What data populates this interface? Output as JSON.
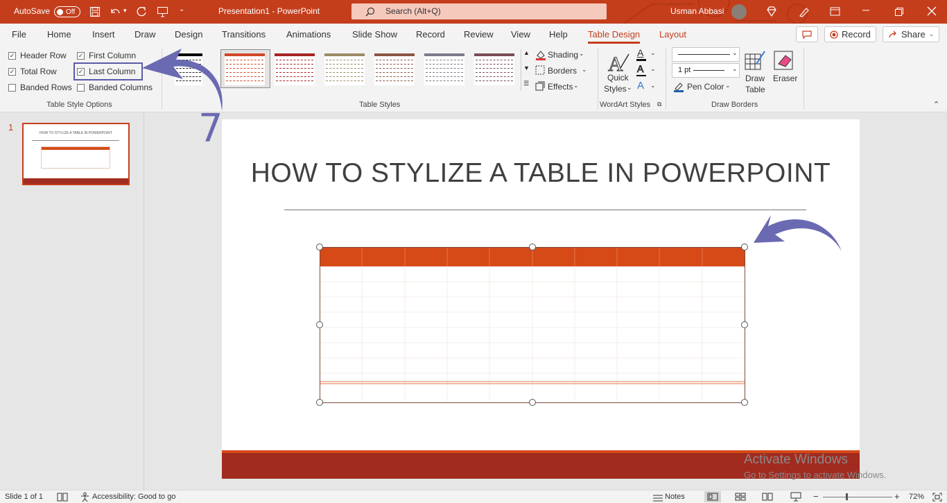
{
  "titlebar": {
    "autosave_label": "AutoSave",
    "autosave_state": "Off",
    "doc_title": "Presentation1  -  PowerPoint",
    "search_placeholder": "Search (Alt+Q)",
    "user_name": "Usman Abbasi"
  },
  "menu": {
    "tabs": [
      "File",
      "Home",
      "Insert",
      "Draw",
      "Design",
      "Transitions",
      "Animations",
      "Slide Show",
      "Record",
      "Review",
      "View",
      "Help",
      "Table Design",
      "Layout"
    ],
    "active_tab": "Table Design",
    "record_label": "Record",
    "share_label": "Share"
  },
  "ribbon": {
    "style_options": {
      "header_row": {
        "label": "Header Row",
        "checked": true
      },
      "first_column": {
        "label": "First Column",
        "checked": true
      },
      "total_row": {
        "label": "Total Row",
        "checked": true
      },
      "last_column": {
        "label": "Last Column",
        "checked": true
      },
      "banded_rows": {
        "label": "Banded Rows",
        "checked": false
      },
      "banded_columns": {
        "label": "Banded Columns",
        "checked": false
      },
      "group_label": "Table Style Options"
    },
    "table_styles": {
      "group_label": "Table Styles",
      "style_colors": [
        "#000000",
        "#d24726",
        "#a72424",
        "#9c8b66",
        "#8b5545",
        "#7d7a89",
        "#7a4d55"
      ]
    },
    "shading_label": "Shading",
    "borders_label": "Borders",
    "effects_label": "Effects",
    "quick_styles_label1": "Quick",
    "quick_styles_label2": "Styles",
    "wordart_label": "WordArt Styles",
    "pen_weight": "1 pt",
    "pen_color_label": "Pen Color",
    "draw_table_label1": "Draw",
    "draw_table_label2": "Table",
    "eraser_label": "Eraser",
    "draw_borders_label": "Draw Borders"
  },
  "annotation": {
    "step_number": "7",
    "arrow_color": "#6a6ab2"
  },
  "slide_panel": {
    "slide_number": "1",
    "thumb_title": "HOW TO STYLIZE A TABLE IN POWERPOINT"
  },
  "slide": {
    "title": "HOW TO STYLIZE A TABLE IN POWERPOINT",
    "table_header_color": "#d64a18",
    "footer_color": "#a12b1f",
    "watermark_line1": "Activate Windows",
    "watermark_line2": "Go to Settings to activate Windows."
  },
  "status": {
    "slide_counter": "Slide 1 of 1",
    "accessibility": "Accessibility: Good to go",
    "notes_label": "Notes",
    "zoom_level": "72%"
  },
  "colors": {
    "accent": "#c43e1c"
  }
}
